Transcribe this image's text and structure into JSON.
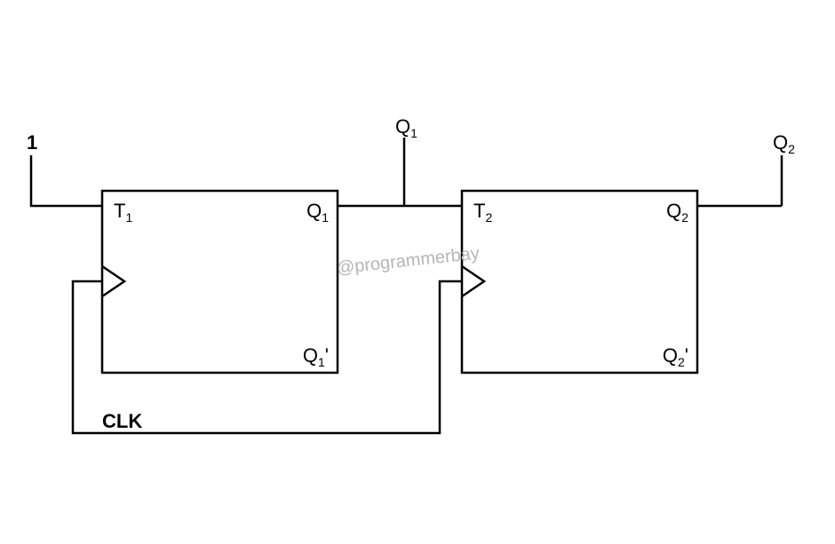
{
  "input_constant": "1",
  "clock_label": "CLK",
  "watermark": "@programmerbay",
  "ff1": {
    "t_label": "T",
    "t_sub": "1",
    "q_label": "Q",
    "q_sub": "1",
    "qbar_label": "Q",
    "qbar_sub": "1",
    "qbar_prime": "'"
  },
  "ff2": {
    "t_label": "T",
    "t_sub": "2",
    "q_label": "Q",
    "q_sub": "2",
    "qbar_label": "Q",
    "qbar_sub": "2",
    "qbar_prime": "'"
  },
  "out1": {
    "label": "Q",
    "sub": "1"
  },
  "out2": {
    "label": "Q",
    "sub": "2"
  }
}
